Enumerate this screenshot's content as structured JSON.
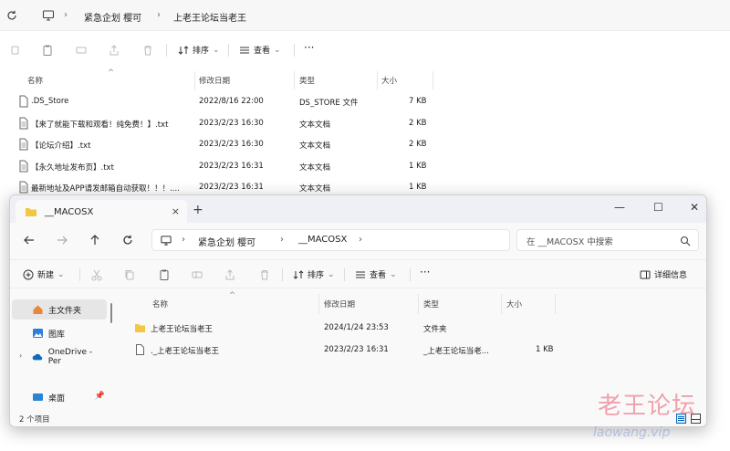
{
  "background_window": {
    "breadcrumb": [
      "紧急企划 樱可",
      "上老王论坛当老王"
    ],
    "toolbar": {
      "sort_label": "排序",
      "view_label": "查看"
    },
    "columns": {
      "name": "名称",
      "date": "修改日期",
      "type": "类型",
      "size": "大小"
    },
    "files": [
      {
        "name": ".DS_Store",
        "date": "2022/8/16 22:00",
        "type": "DS_STORE 文件",
        "size": "7 KB"
      },
      {
        "name": "【来了就能下载和观看！纯免费！】.txt",
        "date": "2023/2/23 16:30",
        "type": "文本文档",
        "size": "2 KB"
      },
      {
        "name": "【论坛介绍】.txt",
        "date": "2023/2/23 16:30",
        "type": "文本文档",
        "size": "2 KB"
      },
      {
        "name": "【永久地址发布页】.txt",
        "date": "2023/2/23 16:31",
        "type": "文本文档",
        "size": "1 KB"
      },
      {
        "name": "最新地址及APP请发邮箱自动获取！！！....",
        "date": "2023/2/23 16:31",
        "type": "文本文档",
        "size": "1 KB"
      }
    ]
  },
  "foreground_window": {
    "tab_title": "__MACOSX",
    "tab_close": "×",
    "new_tab": "+",
    "window_controls": {
      "minimize": "—",
      "maximize": "☐",
      "close": "✕"
    },
    "breadcrumb": [
      "紧急企划 樱可",
      "__MACOSX"
    ],
    "search_placeholder": "在 __MACOSX 中搜索",
    "toolbar": {
      "new_label": "新建",
      "sort_label": "排序",
      "view_label": "查看",
      "more_label": "···",
      "details_label": "详细信息"
    },
    "sidebar": [
      {
        "label": "主文件夹",
        "icon": "home-icon",
        "selected": true
      },
      {
        "label": "图库",
        "icon": "gallery-icon",
        "selected": false
      },
      {
        "label": "OneDrive - Per",
        "icon": "onedrive-icon",
        "selected": false
      },
      {
        "label": "桌面",
        "icon": "desktop-icon",
        "selected": false
      }
    ],
    "columns": {
      "name": "名称",
      "date": "修改日期",
      "type": "类型",
      "size": "大小"
    },
    "files": [
      {
        "name": "上老王论坛当老王",
        "date": "2024/1/24 23:53",
        "type": "文件夹",
        "size": "",
        "icon": "folder-icon"
      },
      {
        "name": "._上老王论坛当老王",
        "date": "2023/2/23 16:31",
        "type": "_上老王论坛当老...",
        "size": "1 KB",
        "icon": "file-icon"
      }
    ],
    "status_count": "2 个项目"
  },
  "watermark": {
    "text": "老王论坛",
    "subtext": "laowang.vip"
  },
  "colors": {
    "folder": "#f2c744",
    "accent": "#0067c0",
    "watermark": "#e85a6e"
  }
}
